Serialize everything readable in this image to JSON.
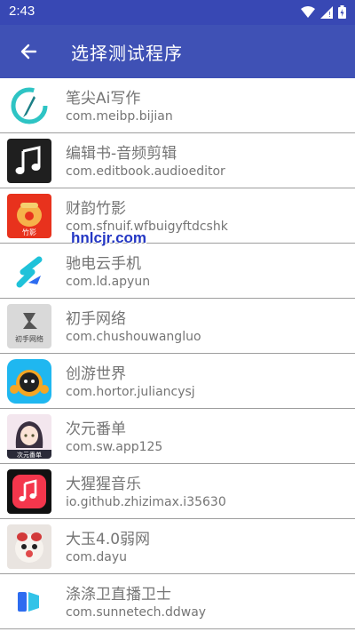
{
  "status_bar": {
    "time": "2:43"
  },
  "app_bar": {
    "title": "选择测试程序"
  },
  "apps": [
    {
      "name": "笔尖Ai写作",
      "package": "com.meibp.bijian"
    },
    {
      "name": "编辑书-音频剪辑",
      "package": "com.editbook.audioeditor"
    },
    {
      "name": "财韵竹影",
      "package": "com.sfnuif.wfbuigyftdcshk",
      "icon_text": "竹影"
    },
    {
      "name": "驰电云手机",
      "package": "com.ld.apyun"
    },
    {
      "name": "初手网络",
      "package": "com.chushouwangluo",
      "icon_text": "初手网络"
    },
    {
      "name": "创游世界",
      "package": "com.hortor.juliancysj"
    },
    {
      "name": "次元番单",
      "package": "com.sw.app125",
      "icon_text": "次元番单"
    },
    {
      "name": "大猩猩音乐",
      "package": "io.github.zhizimax.i35630"
    },
    {
      "name": "大玉4.0弱网",
      "package": "com.dayu"
    },
    {
      "name": "涤涤卫直播卫士",
      "package": "com.sunnetech.ddway"
    }
  ],
  "watermark": "hnlcjr.com"
}
